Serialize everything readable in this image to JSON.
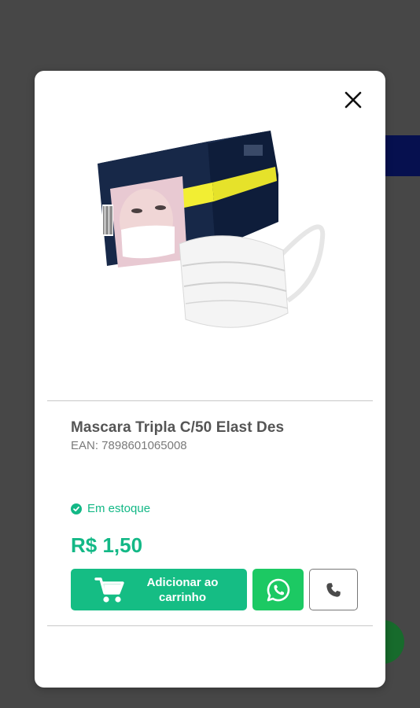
{
  "product": {
    "name": "Mascara Tripla C/50 Elast Des",
    "ean": "EAN: 7898601065008",
    "stock_status": "Em estoque",
    "price": "R$ 1,50",
    "image_icon": "mask-product-image"
  },
  "actions": {
    "add_to_cart_label": "Adicionar ao\ncarrinho",
    "cart_icon": "cart-icon",
    "whatsapp_icon": "whatsapp-icon",
    "phone_icon": "phone-icon",
    "close_icon": "close-icon"
  },
  "colors": {
    "accent_green": "#13b886",
    "whatsapp_green": "#1cc963",
    "overlay": "#474747",
    "navy": "#06104f"
  }
}
